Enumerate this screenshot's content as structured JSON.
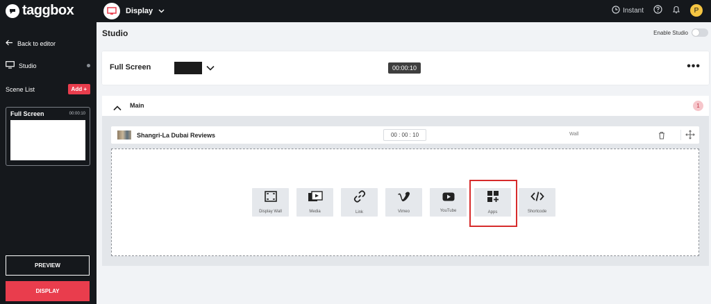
{
  "topbar": {
    "brand": "taggbox",
    "display_label": "Display",
    "instant_label": "Instant",
    "user_initial": "P"
  },
  "sidebar": {
    "back_label": "Back to editor",
    "studio_label": "Studio",
    "scene_list_label": "Scene List",
    "add_label": "Add +",
    "scene_card": {
      "title": "Full Screen",
      "duration": "00:00:10"
    },
    "preview_label": "PREVIEW",
    "display_label": "DISPLAY"
  },
  "header": {
    "title": "Studio",
    "enable_studio_label": "Enable Studio"
  },
  "full_screen": {
    "title": "Full Screen",
    "timer": "00:00:10"
  },
  "main": {
    "label": "Main",
    "count": "1",
    "feed": {
      "title": "Shangri-La Dubai Reviews",
      "time": "00 : 00 : 10",
      "type": "Wall"
    },
    "tiles": [
      {
        "label": "Display Wall",
        "icon": "display-wall-icon"
      },
      {
        "label": "Media",
        "icon": "media-icon"
      },
      {
        "label": "Link",
        "icon": "link-icon"
      },
      {
        "label": "Vimeo",
        "icon": "vimeo-icon"
      },
      {
        "label": "YouTube",
        "icon": "youtube-icon"
      },
      {
        "label": "Apps",
        "icon": "apps-icon"
      },
      {
        "label": "Shortcode",
        "icon": "shortcode-icon"
      }
    ]
  },
  "colors": {
    "accent": "#e93d4d",
    "dark": "#15181c",
    "highlight": "#d62b2b"
  }
}
